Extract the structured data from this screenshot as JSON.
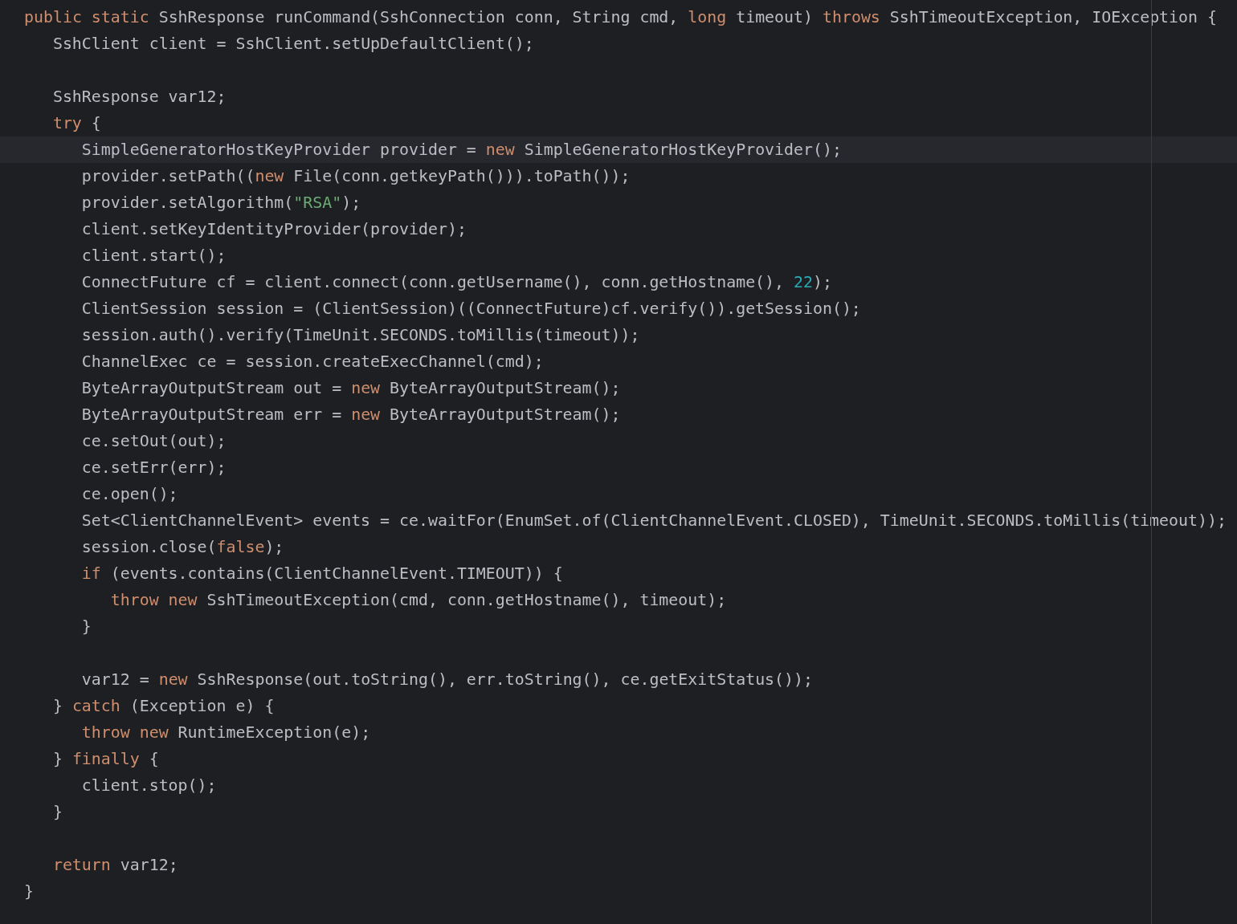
{
  "editor": {
    "lines": [
      {
        "current": false,
        "tokens": [
          {
            "kind": "keyword",
            "text": "public static"
          },
          {
            "kind": "plain",
            "text": " SshResponse runCommand(SshConnection conn, String cmd, "
          },
          {
            "kind": "keyword",
            "text": "long"
          },
          {
            "kind": "plain",
            "text": " timeout) "
          },
          {
            "kind": "keyword",
            "text": "throws"
          },
          {
            "kind": "plain",
            "text": " SshTimeoutException, IOException {"
          }
        ],
        "children": [
          {
            "current": false,
            "tokens": [
              {
                "kind": "plain",
                "text": "SshClient client = SshClient.setUpDefaultClient();"
              }
            ]
          },
          {
            "current": false
          },
          {
            "current": false,
            "tokens": [
              {
                "kind": "plain",
                "text": "SshResponse var12;"
              }
            ]
          },
          {
            "current": false,
            "tokens": [
              {
                "kind": "keyword",
                "text": "try"
              },
              {
                "kind": "plain",
                "text": " {"
              }
            ],
            "children": [
              {
                "current": true,
                "tokens": [
                  {
                    "kind": "plain",
                    "text": "SimpleGeneratorHostKeyProvider provider = "
                  },
                  {
                    "kind": "keyword",
                    "text": "new"
                  },
                  {
                    "kind": "plain",
                    "text": " SimpleGeneratorHostKeyProvider();"
                  }
                ]
              },
              {
                "current": false,
                "tokens": [
                  {
                    "kind": "plain",
                    "text": "provider.setPath(("
                  },
                  {
                    "kind": "keyword",
                    "text": "new"
                  },
                  {
                    "kind": "plain",
                    "text": " File(conn.getkeyPath())).toPath());"
                  }
                ]
              },
              {
                "current": false,
                "tokens": [
                  {
                    "kind": "plain",
                    "text": "provider.setAlgorithm("
                  },
                  {
                    "kind": "string",
                    "text": "\"RSA\""
                  },
                  {
                    "kind": "plain",
                    "text": ");"
                  }
                ]
              },
              {
                "current": false,
                "tokens": [
                  {
                    "kind": "plain",
                    "text": "client.setKeyIdentityProvider(provider);"
                  }
                ]
              },
              {
                "current": false,
                "tokens": [
                  {
                    "kind": "plain",
                    "text": "client.start();"
                  }
                ]
              },
              {
                "current": false,
                "tokens": [
                  {
                    "kind": "plain",
                    "text": "ConnectFuture cf = client.connect(conn.getUsername(), conn.getHostname(), "
                  },
                  {
                    "kind": "number",
                    "text": "22"
                  },
                  {
                    "kind": "plain",
                    "text": ");"
                  }
                ]
              },
              {
                "current": false,
                "tokens": [
                  {
                    "kind": "plain",
                    "text": "ClientSession session = (ClientSession)((ConnectFuture)cf.verify()).getSession();"
                  }
                ]
              },
              {
                "current": false,
                "tokens": [
                  {
                    "kind": "plain",
                    "text": "session.auth().verify(TimeUnit.SECONDS.toMillis(timeout));"
                  }
                ]
              },
              {
                "current": false,
                "tokens": [
                  {
                    "kind": "plain",
                    "text": "ChannelExec ce = session.createExecChannel(cmd);"
                  }
                ]
              },
              {
                "current": false,
                "tokens": [
                  {
                    "kind": "plain",
                    "text": "ByteArrayOutputStream out = "
                  },
                  {
                    "kind": "keyword",
                    "text": "new"
                  },
                  {
                    "kind": "plain",
                    "text": " ByteArrayOutputStream();"
                  }
                ]
              },
              {
                "current": false,
                "tokens": [
                  {
                    "kind": "plain",
                    "text": "ByteArrayOutputStream err = "
                  },
                  {
                    "kind": "keyword",
                    "text": "new"
                  },
                  {
                    "kind": "plain",
                    "text": " ByteArrayOutputStream();"
                  }
                ]
              },
              {
                "current": false,
                "tokens": [
                  {
                    "kind": "plain",
                    "text": "ce.setOut(out);"
                  }
                ]
              },
              {
                "current": false,
                "tokens": [
                  {
                    "kind": "plain",
                    "text": "ce.setErr(err);"
                  }
                ]
              },
              {
                "current": false,
                "tokens": [
                  {
                    "kind": "plain",
                    "text": "ce.open();"
                  }
                ]
              },
              {
                "current": false,
                "tokens": [
                  {
                    "kind": "plain",
                    "text": "Set<ClientChannelEvent> events = ce.waitFor(EnumSet.of(ClientChannelEvent.CLOSED), TimeUnit.SECONDS.toMillis(timeout));"
                  }
                ]
              },
              {
                "current": false,
                "tokens": [
                  {
                    "kind": "plain",
                    "text": "session.close("
                  },
                  {
                    "kind": "keyword",
                    "text": "false"
                  },
                  {
                    "kind": "plain",
                    "text": ");"
                  }
                ]
              },
              {
                "current": false,
                "tokens": [
                  {
                    "kind": "keyword",
                    "text": "if"
                  },
                  {
                    "kind": "plain",
                    "text": " (events.contains(ClientChannelEvent.TIMEOUT)) {"
                  }
                ],
                "children": [
                  {
                    "current": false,
                    "tokens": [
                      {
                        "kind": "keyword",
                        "text": "throw new"
                      },
                      {
                        "kind": "plain",
                        "text": " SshTimeoutException(cmd, conn.getHostname(), timeout);"
                      }
                    ]
                  }
                ]
              },
              {
                "current": false,
                "tokens": [
                  {
                    "kind": "plain",
                    "text": "}"
                  }
                ]
              },
              {
                "current": false
              },
              {
                "current": false,
                "tokens": [
                  {
                    "kind": "plain",
                    "text": "var12 = "
                  },
                  {
                    "kind": "keyword",
                    "text": "new"
                  },
                  {
                    "kind": "plain",
                    "text": " SshResponse(out.toString(), err.toString(), ce.getExitStatus());"
                  }
                ]
              }
            ]
          },
          {
            "current": false,
            "tokens": [
              {
                "kind": "plain",
                "text": "} "
              },
              {
                "kind": "keyword",
                "text": "catch"
              },
              {
                "kind": "plain",
                "text": " (Exception e) {"
              }
            ],
            "children": [
              {
                "current": false,
                "tokens": [
                  {
                    "kind": "keyword",
                    "text": "throw new"
                  },
                  {
                    "kind": "plain",
                    "text": " RuntimeException(e);"
                  }
                ]
              }
            ]
          },
          {
            "current": false,
            "tokens": [
              {
                "kind": "plain",
                "text": "} "
              },
              {
                "kind": "keyword",
                "text": "finally"
              },
              {
                "kind": "plain",
                "text": " {"
              }
            ],
            "children": [
              {
                "current": false,
                "tokens": [
                  {
                    "kind": "plain",
                    "text": "client.stop();"
                  }
                ]
              }
            ]
          },
          {
            "current": false,
            "tokens": [
              {
                "kind": "plain",
                "text": "}"
              }
            ]
          },
          {
            "current": false
          },
          {
            "current": false,
            "tokens": [
              {
                "kind": "keyword",
                "text": "return"
              },
              {
                "kind": "plain",
                "text": " var12;"
              }
            ]
          }
        ]
      },
      {
        "current": false,
        "tokens": [
          {
            "kind": "plain",
            "text": "}"
          }
        ]
      }
    ]
  }
}
